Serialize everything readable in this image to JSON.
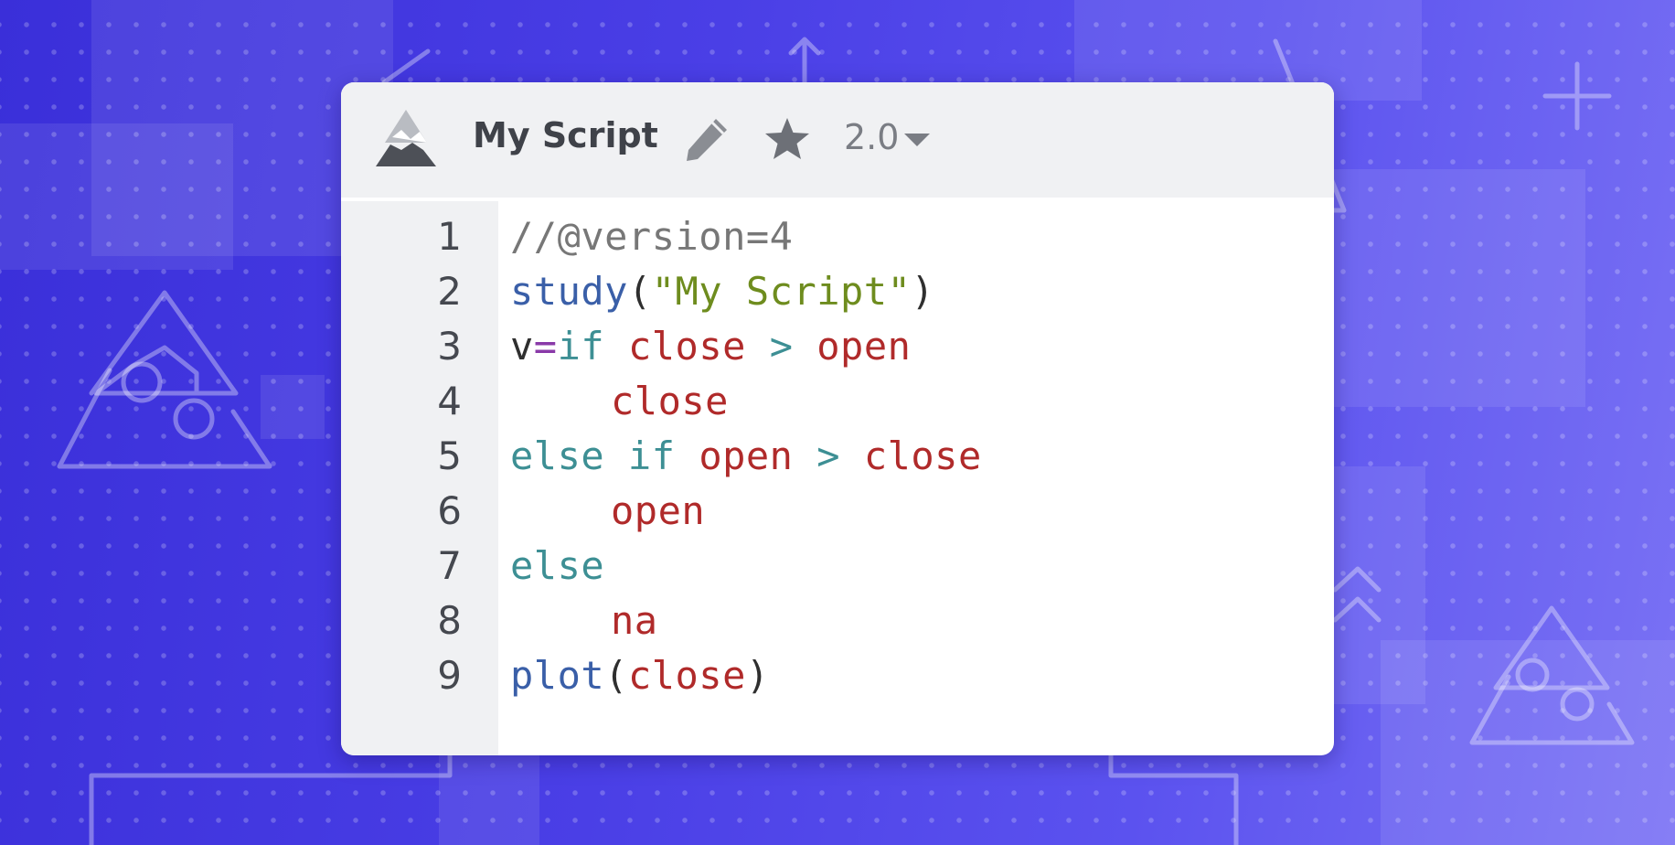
{
  "app": {
    "script_title": "My Script",
    "version": "2.0",
    "icons": [
      "mountain-logo-icon",
      "pencil-icon",
      "star-icon",
      "chevron-down-icon"
    ]
  },
  "editor": {
    "lines": [
      {
        "num": "1",
        "tokens": [
          {
            "t": "//@version=4",
            "k": "comment"
          }
        ]
      },
      {
        "num": "2",
        "tokens": [
          {
            "t": "study",
            "k": "func"
          },
          {
            "t": "(",
            "k": "punc"
          },
          {
            "t": "\"My Script\"",
            "k": "str"
          },
          {
            "t": ")",
            "k": "punc"
          }
        ]
      },
      {
        "num": "3",
        "tokens": [
          {
            "t": "v",
            "k": "plain"
          },
          {
            "t": "=",
            "k": "eq"
          },
          {
            "t": "if",
            "k": "kw"
          },
          {
            "t": " ",
            "k": "plain"
          },
          {
            "t": "close",
            "k": "var"
          },
          {
            "t": " > ",
            "k": "op"
          },
          {
            "t": "open",
            "k": "var"
          }
        ]
      },
      {
        "num": "4",
        "indent": true,
        "tokens": [
          {
            "t": "close",
            "k": "var"
          }
        ]
      },
      {
        "num": "5",
        "tokens": [
          {
            "t": "else if",
            "k": "kw"
          },
          {
            "t": " ",
            "k": "plain"
          },
          {
            "t": "open",
            "k": "var"
          },
          {
            "t": " > ",
            "k": "op"
          },
          {
            "t": "close",
            "k": "var"
          }
        ]
      },
      {
        "num": "6",
        "indent": true,
        "tokens": [
          {
            "t": "open",
            "k": "var"
          }
        ]
      },
      {
        "num": "7",
        "tokens": [
          {
            "t": "else",
            "k": "kw"
          }
        ]
      },
      {
        "num": "8",
        "indent": true,
        "tokens": [
          {
            "t": "na",
            "k": "var"
          }
        ]
      },
      {
        "num": "9",
        "tokens": [
          {
            "t": "plot",
            "k": "func"
          },
          {
            "t": "(",
            "k": "punc"
          },
          {
            "t": "close",
            "k": "var"
          },
          {
            "t": ")",
            "k": "punc"
          }
        ]
      }
    ]
  },
  "colors": {
    "background": "#4a3fe6",
    "comment": "#777777",
    "function": "#3a5fa8",
    "string": "#6e8c1e",
    "keyword": "#3d8f94",
    "variable": "#b02a2a"
  }
}
